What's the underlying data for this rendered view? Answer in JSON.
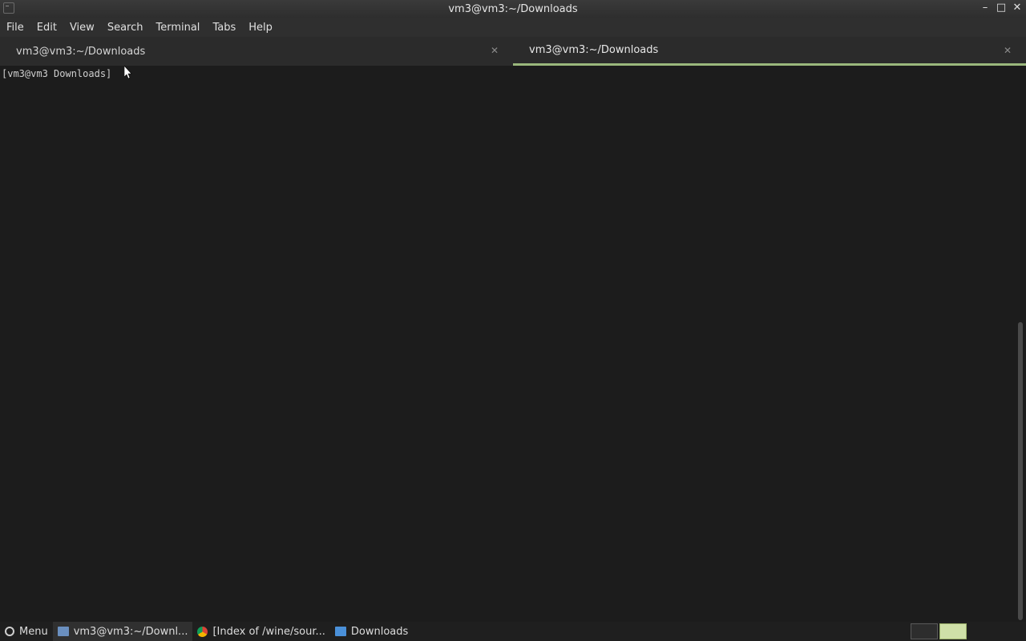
{
  "window": {
    "title": "vm3@vm3:~/Downloads"
  },
  "menubar": {
    "items": [
      "File",
      "Edit",
      "View",
      "Search",
      "Terminal",
      "Tabs",
      "Help"
    ]
  },
  "tabs": [
    {
      "label": "vm3@vm3:~/Downloads",
      "active": false
    },
    {
      "label": "vm3@vm3:~/Downloads",
      "active": true
    }
  ],
  "terminal": {
    "prompt": "[vm3@vm3 Downloads]"
  },
  "taskbar": {
    "menu_label": "Menu",
    "items": [
      {
        "label": "vm3@vm3:~/Downl...",
        "icon": "terminal-icon",
        "active": true
      },
      {
        "label": "[Index of /wine/sour...",
        "icon": "chrome-icon",
        "active": false
      },
      {
        "label": "Downloads",
        "icon": "folder-icon",
        "active": false
      }
    ]
  },
  "colors": {
    "accent": "#9ab87c",
    "background": "#1c1c1c"
  }
}
